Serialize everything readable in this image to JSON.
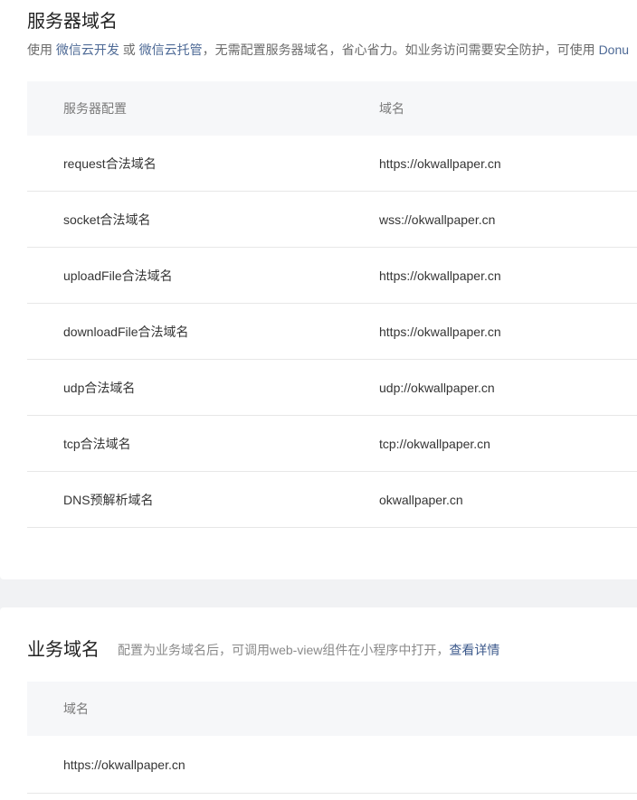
{
  "server_domain": {
    "title": "服务器域名",
    "desc_prefix": "使用",
    "link_cloud_dev": "微信云开发",
    "desc_or": "或",
    "link_cloud_host": "微信云托管",
    "desc_suffix": "，无需配置服务器域名，省心省力。如业务访问需要安全防护，可使用",
    "desc_trailing": "Donu",
    "table": {
      "headers": [
        "服务器配置",
        "域名"
      ],
      "rows": [
        {
          "config": "request合法域名",
          "domain": "https://okwallpaper.cn"
        },
        {
          "config": "socket合法域名",
          "domain": "wss://okwallpaper.cn"
        },
        {
          "config": "uploadFile合法域名",
          "domain": "https://okwallpaper.cn"
        },
        {
          "config": "downloadFile合法域名",
          "domain": "https://okwallpaper.cn"
        },
        {
          "config": "udp合法域名",
          "domain": "udp://okwallpaper.cn"
        },
        {
          "config": "tcp合法域名",
          "domain": "tcp://okwallpaper.cn"
        },
        {
          "config": "DNS预解析域名",
          "domain": "okwallpaper.cn"
        }
      ]
    }
  },
  "business_domain": {
    "title": "业务域名",
    "desc": "配置为业务域名后，可调用web-view组件在小程序中打开，",
    "link_details": "查看详情",
    "table": {
      "header": "域名",
      "rows": [
        "https://okwallpaper.cn"
      ]
    }
  }
}
